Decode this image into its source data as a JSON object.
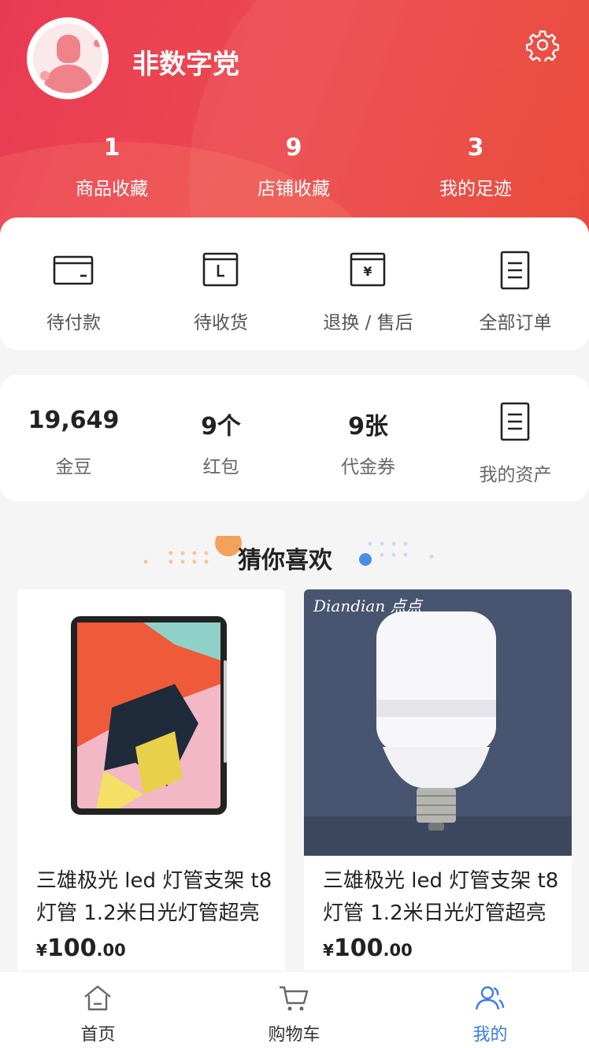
{
  "user": {
    "name": "非数字党"
  },
  "stats": [
    {
      "value": "1",
      "label": "商品收藏"
    },
    {
      "value": "9",
      "label": "店铺收藏"
    },
    {
      "value": "3",
      "label": "我的足迹"
    }
  ],
  "orders": [
    {
      "label": "待付款",
      "icon": "wallet-icon"
    },
    {
      "label": "待收货",
      "icon": "clock-box-icon"
    },
    {
      "label": "退换 / 售后",
      "icon": "refund-icon"
    },
    {
      "label": "全部订单",
      "icon": "document-icon"
    }
  ],
  "assets": [
    {
      "value": "19,649",
      "label": "金豆"
    },
    {
      "value": "9个",
      "label": "红包"
    },
    {
      "value": "9张",
      "label": "代金券"
    },
    {
      "label": "我的资产",
      "icon": "document-icon"
    }
  ],
  "recommend": {
    "title": "猜你喜欢"
  },
  "products": [
    {
      "name": "三雄极光 led 灯管支架 t8 灯管 1.2米日光灯管超亮",
      "currency": "¥",
      "price_int": "100",
      "price_dec": ".00"
    },
    {
      "name": "三雄极光 led 灯管支架 t8 灯管 1.2米日光灯管超亮",
      "currency": "¥",
      "price_int": "100",
      "price_dec": ".00",
      "brand": "Diandian 点点"
    }
  ],
  "tabbar": [
    {
      "label": "首页",
      "icon": "home-icon"
    },
    {
      "label": "购物车",
      "icon": "cart-icon"
    },
    {
      "label": "我的",
      "icon": "user-icon",
      "active": true
    }
  ],
  "colors": {
    "header_start": "#e93a55",
    "header_end": "#e8402f",
    "tab_active": "#3a7be8"
  }
}
